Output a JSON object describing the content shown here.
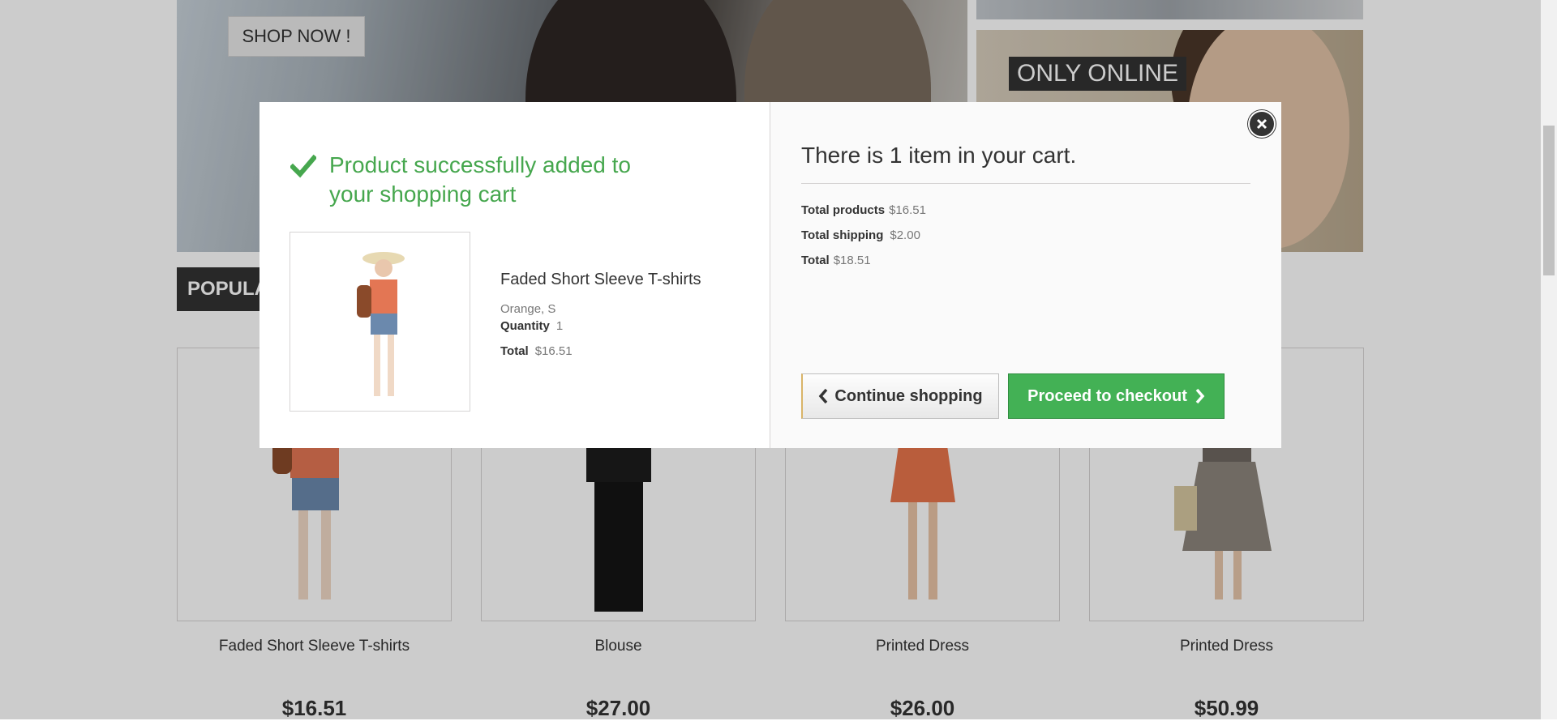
{
  "background": {
    "banner_button": "SHOP NOW !",
    "side_banner_label": "ONLY ONLINE",
    "section_tab": "POPULA"
  },
  "products": [
    {
      "name": "Faded Short Sleeve T-shirts",
      "price": "$16.51"
    },
    {
      "name": "Blouse",
      "price": "$27.00"
    },
    {
      "name": "Printed Dress",
      "price": "$26.00"
    },
    {
      "name": "Printed Dress",
      "price": "$50.99"
    }
  ],
  "modal": {
    "success_message": "Product successfully added to your shopping cart",
    "product_name": "Faded Short Sleeve T-shirts",
    "attributes": "Orange, S",
    "quantity_label": "Quantity",
    "quantity_value": "1",
    "total_label": "Total",
    "total_value": "$16.51",
    "cart_summary": "There is 1 item in your cart.",
    "total_products_label": "Total products",
    "total_products_value": "$16.51",
    "total_shipping_label": "Total shipping",
    "total_shipping_value": "$2.00",
    "grand_total_label": "Total",
    "grand_total_value": "$18.51",
    "continue_label": "Continue shopping",
    "checkout_label": "Proceed to checkout"
  },
  "colors": {
    "success_green": "#46a74e",
    "checkout_button": "#43b155",
    "dark": "#333333"
  },
  "icons": [
    "check-icon",
    "close-icon",
    "chevron-left-icon",
    "chevron-right-icon"
  ]
}
